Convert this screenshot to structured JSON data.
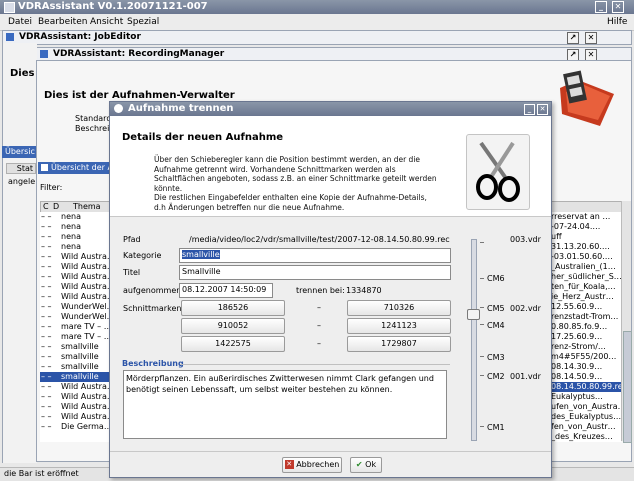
{
  "app": {
    "title": "VDRAssistant V0.1.20071121-007"
  },
  "menu": {
    "items": [
      "Datei",
      "Bearbeiten",
      "Ansicht",
      "Spezial"
    ],
    "help": "Hilfe"
  },
  "job_editor": {
    "title": "VDRAssistant: JobEditor"
  },
  "recording_manager": {
    "title": "VDRAssistant: RecordingManager",
    "left_heading": "Dies",
    "heading": "Dies ist der Aufnahmen-Verwalter",
    "line1": "Standardr",
    "line2": "Beschreib",
    "tab": "Übersic",
    "status_col": "Stat",
    "status_val": "angele"
  },
  "overview": {
    "title": "Übersicht der A",
    "filter_label": "Filter:",
    "columns": [
      "C",
      "D",
      "Thema"
    ],
    "rows": [
      "nena",
      "nena",
      "nena",
      "nena",
      "Wild Austra…",
      "Wild Austra…",
      "Wild Austra…",
      "Wild Austra…",
      "Wild Austra…",
      "WunderWel…",
      "WunderWel…",
      "mare TV – …",
      "mare TV – …",
      "smallville",
      "smallville",
      "smallville",
      "smallville",
      "Wild Austra…",
      "Wild Austra…",
      "Wild Austra…",
      "Wild Austra…",
      "Die Germa…"
    ],
    "selected_index": 16,
    "right_rows": [
      "rreservat an …",
      "-07-24.04.…",
      "uff",
      "31.13.20.60.…",
      "-03.01.50.60.…",
      "_Australien_(1…",
      "her_südlicher_S…",
      "ten_für_Koala,…",
      "ie_Herz_Austr…",
      "12.55.60.9…",
      "renzstadt-Trom…",
      "0.80.85.fo.9…",
      "17.25.60.9…",
      "renz-Strom/…",
      "m4#5F55/200…",
      "08.14.30.9…",
      "08.14.50.9…",
      "08.14.50.80.99.rec",
      "Eukalyptus…",
      "ufen_von_Austra…",
      "des_Eukalyptus…",
      "fen_von_Austr…",
      "_des_Kreuzes…"
    ],
    "right_selected_index": 17
  },
  "statusbar": {
    "text": "die Bar ist eröffnet"
  },
  "dialog": {
    "title": "Aufnahme trennen",
    "header_title": "Details der neuen Aufnahme",
    "description": [
      "Über den Schieberegler kann die Position bestimmt werden, an der die",
      "Aufnahme getrennt wird. Vorhandene Schnittmarken werden als",
      "Schaltflächen angeboten, sodass z.B. an einer Schnittmarke geteilt werden",
      "könnte.",
      "Die restlichen Eingabefelder enthalten eine Kopie der Aufnahme-Details,",
      "d.h Änderungen betreffen nur die neue Aufnahme."
    ],
    "pfad_label": "Pfad",
    "pfad_value": "/media/video/loc2/vdr/smallville/test/2007-12-08.14.50.80.99.rec",
    "kategorie_label": "Kategorie",
    "kategorie_value": "smallville",
    "titel_label": "Titel",
    "titel_value": "Smallville",
    "aufgenommen_label": "aufgenommen",
    "aufgenommen_value": "08.12.2007 14:50:09",
    "trennen_label": "trennen bei:",
    "trennen_value": "1334870",
    "schnittmarken_label": "Schnittmarken",
    "marks": [
      [
        "186526",
        "710326"
      ],
      [
        "910052",
        "1241123"
      ],
      [
        "1422575",
        "1729807"
      ]
    ],
    "dash": "–",
    "beschreibung_label": "Beschreibung",
    "beschreibung_text": "Mörderpflanzen. Ein außerirdisches Zwitterwesen nimmt Clark gefangen und benötigt seinen Lebenssaft, um selbst weiter bestehen zu können.",
    "slider_labels": {
      "v003": "003.vdr",
      "cm6": "CM6",
      "cm5": "CM5",
      "v002": "002.vdr",
      "cm4": "CM4",
      "cm3": "CM3",
      "cm2": "CM2",
      "v001": "001.vdr",
      "cm1": "CM1"
    },
    "cancel_label": "Abbrechen",
    "ok_label": "Ok"
  },
  "colors": {
    "accent": "#2b54a8",
    "titlebar": "#6a7690",
    "cancel_icon": "#c0392b",
    "ok_icon": "#2e8b2e"
  }
}
